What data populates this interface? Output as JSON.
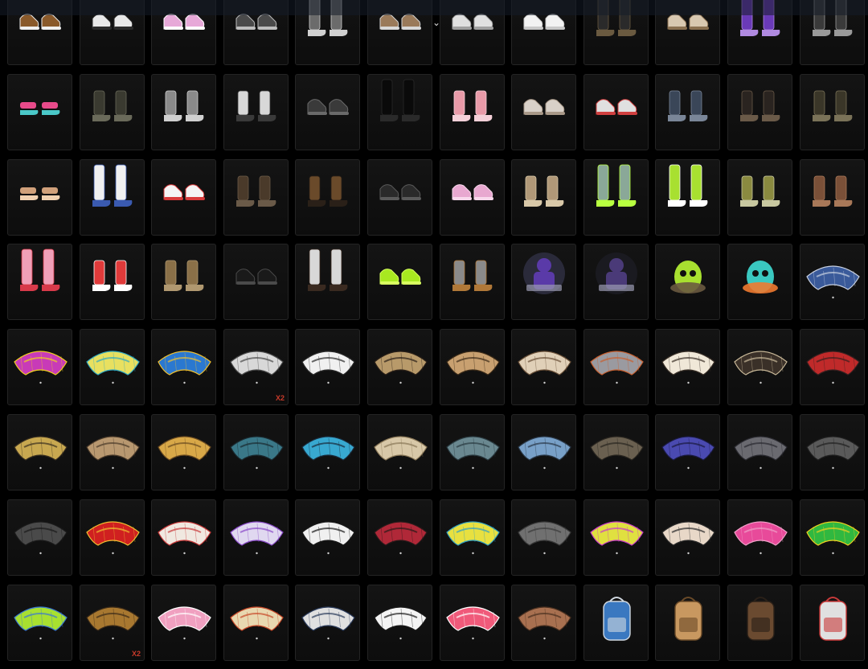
{
  "inventory": {
    "rows": [
      [
        {
          "kind": "shoes",
          "colors": [
            "#8a5a2b",
            "#f0f0f0"
          ],
          "style": "sneaker"
        },
        {
          "kind": "shoes",
          "colors": [
            "#e8e8e8",
            "#2a2a2a"
          ],
          "style": "sneaker"
        },
        {
          "kind": "shoes",
          "colors": [
            "#e7a9d8",
            "#ffffff"
          ],
          "style": "sneaker"
        },
        {
          "kind": "shoes",
          "colors": [
            "#4a4a4a",
            "#bdbdbd"
          ],
          "style": "sneaker"
        },
        {
          "kind": "shoes",
          "colors": [
            "#6b6b6b",
            "#d0d0d0"
          ],
          "style": "tall"
        },
        {
          "kind": "shoes",
          "colors": [
            "#9a7a5a",
            "#d8d8d8"
          ],
          "style": "sneaker"
        },
        {
          "kind": "shoes",
          "colors": [
            "#e0e0e0",
            "#a0a0a0"
          ],
          "style": "sneaker"
        },
        {
          "kind": "shoes",
          "colors": [
            "#f2f2f2",
            "#c8c8c8"
          ],
          "style": "sneaker"
        },
        {
          "kind": "shoes",
          "colors": [
            "#2a2a2a",
            "#6a5a40"
          ],
          "style": "tall"
        },
        {
          "kind": "shoes",
          "colors": [
            "#d8c8b0",
            "#8a7050"
          ],
          "style": "sneaker"
        },
        {
          "kind": "shoes",
          "colors": [
            "#6a3ab8",
            "#b08ae0"
          ],
          "style": "tall"
        },
        {
          "kind": "shoes",
          "colors": [
            "#3a3a3a",
            "#9a9a9a"
          ],
          "style": "tall"
        }
      ],
      [
        {
          "kind": "shoes",
          "colors": [
            "#e84a8a",
            "#4ac8c8"
          ],
          "style": "sandal"
        },
        {
          "kind": "shoes",
          "colors": [
            "#3a3a30",
            "#6a6a5a"
          ],
          "style": "boot"
        },
        {
          "kind": "shoes",
          "colors": [
            "#8a8a8a",
            "#d0d0d0"
          ],
          "style": "boot"
        },
        {
          "kind": "shoes",
          "colors": [
            "#d8d8d8",
            "#3a3a3a"
          ],
          "style": "boot"
        },
        {
          "kind": "shoes",
          "colors": [
            "#3a3a3a",
            "#6a6a6a"
          ],
          "style": "sneaker"
        },
        {
          "kind": "shoes",
          "colors": [
            "#0a0a0a",
            "#2a2a2a"
          ],
          "style": "tall"
        },
        {
          "kind": "shoes",
          "colors": [
            "#e89aa8",
            "#f4d0d8"
          ],
          "style": "boot"
        },
        {
          "kind": "shoes",
          "colors": [
            "#d8d0c8",
            "#a89888"
          ],
          "style": "sneaker"
        },
        {
          "kind": "shoes",
          "colors": [
            "#e0e0e0",
            "#d04040"
          ],
          "style": "sneaker"
        },
        {
          "kind": "shoes",
          "colors": [
            "#3a4658",
            "#7a8698"
          ],
          "style": "boot"
        },
        {
          "kind": "shoes",
          "colors": [
            "#2a2420",
            "#6a5a48"
          ],
          "style": "boot"
        },
        {
          "kind": "shoes",
          "colors": [
            "#3a3628",
            "#7a7258"
          ],
          "style": "boot"
        }
      ],
      [
        {
          "kind": "shoes",
          "colors": [
            "#d0a07a",
            "#f0d0b0"
          ],
          "style": "sandal"
        },
        {
          "kind": "shoes",
          "colors": [
            "#f0f0f0",
            "#3a5ab0"
          ],
          "style": "tall"
        },
        {
          "kind": "shoes",
          "colors": [
            "#f4f4f4",
            "#d83a3a"
          ],
          "style": "sneaker"
        },
        {
          "kind": "shoes",
          "colors": [
            "#4a3a2a",
            "#6a5a48"
          ],
          "style": "boot"
        },
        {
          "kind": "shoes",
          "colors": [
            "#6a4a2a",
            "#2a2018"
          ],
          "style": "boot"
        },
        {
          "kind": "shoes",
          "colors": [
            "#2a2a2a",
            "#5a5a5a"
          ],
          "style": "sneaker"
        },
        {
          "kind": "shoes",
          "colors": [
            "#e8a8d0",
            "#f8d8ec"
          ],
          "style": "sneaker"
        },
        {
          "kind": "shoes",
          "colors": [
            "#b09878",
            "#d8c8a8"
          ],
          "style": "boot"
        },
        {
          "kind": "shoes",
          "colors": [
            "#8aa898",
            "#b8ff40"
          ],
          "style": "tall"
        },
        {
          "kind": "shoes",
          "colors": [
            "#a8e030",
            "#ffffff"
          ],
          "style": "tall"
        },
        {
          "kind": "shoes",
          "colors": [
            "#8a8a40",
            "#c8c8a0"
          ],
          "style": "boot"
        },
        {
          "kind": "shoes",
          "colors": [
            "#7a5038",
            "#a87858"
          ],
          "style": "boot"
        }
      ],
      [
        {
          "kind": "shoes",
          "colors": [
            "#f0a0b8",
            "#d83a4a"
          ],
          "style": "tall"
        },
        {
          "kind": "shoes",
          "colors": [
            "#e03a3a",
            "#ffffff"
          ],
          "style": "boot"
        },
        {
          "kind": "shoes",
          "colors": [
            "#8a7048",
            "#b09870"
          ],
          "style": "boot"
        },
        {
          "kind": "shoes",
          "colors": [
            "#1a1a1a",
            "#4a4a4a"
          ],
          "style": "sneaker"
        },
        {
          "kind": "shoes",
          "colors": [
            "#d8d8d8",
            "#3a2a20"
          ],
          "style": "tall"
        },
        {
          "kind": "shoes",
          "colors": [
            "#a8e820",
            "#d8ff60"
          ],
          "style": "sneaker"
        },
        {
          "kind": "shoes",
          "colors": [
            "#8a8a8a",
            "#b07838"
          ],
          "style": "boot"
        },
        {
          "kind": "emote",
          "colors": [
            "#5a3aa8",
            "#2a2a3a"
          ],
          "style": "character"
        },
        {
          "kind": "emote",
          "colors": [
            "#4a3a78",
            "#1a1a20"
          ],
          "style": "character"
        },
        {
          "kind": "emote",
          "colors": [
            "#a8e030",
            "#6a5a40"
          ],
          "style": "creature"
        },
        {
          "kind": "emote",
          "colors": [
            "#3ac8c0",
            "#f07a30"
          ],
          "style": "creature"
        },
        {
          "kind": "parachute",
          "colors": [
            "#3a5a9a",
            "#c8d0e0"
          ],
          "style": "canopy"
        }
      ],
      [
        {
          "kind": "parachute",
          "colors": [
            "#c83ab8",
            "#f0d020"
          ],
          "style": "canopy"
        },
        {
          "kind": "parachute",
          "colors": [
            "#e8e060",
            "#30a8c0"
          ],
          "style": "canopy"
        },
        {
          "kind": "parachute",
          "colors": [
            "#2a78d0",
            "#f0c030"
          ],
          "style": "canopy"
        },
        {
          "kind": "parachute",
          "colors": [
            "#d8d8d8",
            "#4a4a4a"
          ],
          "style": "canopy",
          "qty": "X2"
        },
        {
          "kind": "parachute",
          "colors": [
            "#f0f0f0",
            "#2a2a2a"
          ],
          "style": "canopy"
        },
        {
          "kind": "parachute",
          "colors": [
            "#b89a6a",
            "#2a2018"
          ],
          "style": "canopy"
        },
        {
          "kind": "parachute",
          "colors": [
            "#c8a070",
            "#3a2a18"
          ],
          "style": "canopy"
        },
        {
          "kind": "parachute",
          "colors": [
            "#e0d0b8",
            "#6a5038"
          ],
          "style": "canopy"
        },
        {
          "kind": "parachute",
          "colors": [
            "#9a9aa0",
            "#c86030"
          ],
          "style": "canopy"
        },
        {
          "kind": "parachute",
          "colors": [
            "#f0e8d8",
            "#3a3028"
          ],
          "style": "canopy"
        },
        {
          "kind": "parachute",
          "colors": [
            "#3a3028",
            "#c8b898"
          ],
          "style": "canopy"
        },
        {
          "kind": "parachute",
          "colors": [
            "#c02a2a",
            "#3a2020"
          ],
          "style": "canopy"
        }
      ],
      [
        {
          "kind": "parachute",
          "colors": [
            "#c8a850",
            "#3a3020"
          ],
          "style": "canopy"
        },
        {
          "kind": "parachute",
          "colors": [
            "#b89870",
            "#4a3a2a"
          ],
          "style": "canopy"
        },
        {
          "kind": "parachute",
          "colors": [
            "#d8a848",
            "#6a4a20"
          ],
          "style": "canopy"
        },
        {
          "kind": "parachute",
          "colors": [
            "#3a7888",
            "#1a2a30"
          ],
          "style": "canopy"
        },
        {
          "kind": "parachute",
          "colors": [
            "#38a8d0",
            "#1a2a3a"
          ],
          "style": "canopy"
        },
        {
          "kind": "parachute",
          "colors": [
            "#d8c8a8",
            "#8a7858"
          ],
          "style": "canopy"
        },
        {
          "kind": "parachute",
          "colors": [
            "#6a8890",
            "#2a3a40"
          ],
          "style": "canopy"
        },
        {
          "kind": "parachute",
          "colors": [
            "#78a0c8",
            "#2a3848"
          ],
          "style": "canopy"
        },
        {
          "kind": "parachute",
          "colors": [
            "#6a6050",
            "#2a2620"
          ],
          "style": "canopy"
        },
        {
          "kind": "parachute",
          "colors": [
            "#4a4ab0",
            "#1a1a40"
          ],
          "style": "canopy"
        },
        {
          "kind": "parachute",
          "colors": [
            "#6a6a70",
            "#2a2a30"
          ],
          "style": "canopy"
        },
        {
          "kind": "parachute",
          "colors": [
            "#5a5a5a",
            "#202020"
          ],
          "style": "canopy"
        }
      ],
      [
        {
          "kind": "parachute",
          "colors": [
            "#4a4a4a",
            "#1a1a1a"
          ],
          "style": "canopy"
        },
        {
          "kind": "parachute",
          "colors": [
            "#d02020",
            "#f0c030"
          ],
          "style": "canopy"
        },
        {
          "kind": "parachute",
          "colors": [
            "#f0e8e0",
            "#c83a3a"
          ],
          "style": "canopy"
        },
        {
          "kind": "parachute",
          "colors": [
            "#e0d8f0",
            "#8a4ac8"
          ],
          "style": "canopy"
        },
        {
          "kind": "parachute",
          "colors": [
            "#f0f0f0",
            "#1a1a1a"
          ],
          "style": "canopy"
        },
        {
          "kind": "parachute",
          "colors": [
            "#b02838",
            "#2a1a1a"
          ],
          "style": "canopy"
        },
        {
          "kind": "parachute",
          "colors": [
            "#e8e040",
            "#30a0c0"
          ],
          "style": "canopy"
        },
        {
          "kind": "parachute",
          "colors": [
            "#707070",
            "#3a3a3a"
          ],
          "style": "canopy"
        },
        {
          "kind": "parachute",
          "colors": [
            "#e0e040",
            "#c83ac8"
          ],
          "style": "canopy"
        },
        {
          "kind": "parachute",
          "colors": [
            "#e8d8c8",
            "#2a2a2a"
          ],
          "style": "canopy"
        },
        {
          "kind": "parachute",
          "colors": [
            "#e84a9a",
            "#f0a0c8"
          ],
          "style": "canopy"
        },
        {
          "kind": "parachute",
          "colors": [
            "#30b840",
            "#f0d020"
          ],
          "style": "canopy"
        }
      ],
      [
        {
          "kind": "parachute",
          "colors": [
            "#a8e030",
            "#3a78d0"
          ],
          "style": "canopy"
        },
        {
          "kind": "parachute",
          "colors": [
            "#a87830",
            "#3a2a18"
          ],
          "style": "canopy",
          "qty": "X2"
        },
        {
          "kind": "parachute",
          "colors": [
            "#f0a0c0",
            "#ffffff"
          ],
          "style": "canopy"
        },
        {
          "kind": "parachute",
          "colors": [
            "#e8d8b0",
            "#c84a2a"
          ],
          "style": "canopy"
        },
        {
          "kind": "parachute",
          "colors": [
            "#e0e0e0",
            "#2a3a5a"
          ],
          "style": "canopy"
        },
        {
          "kind": "parachute",
          "colors": [
            "#f4f4f4",
            "#1a1a1a"
          ],
          "style": "canopy"
        },
        {
          "kind": "parachute",
          "colors": [
            "#f05a7a",
            "#ffffff"
          ],
          "style": "canopy"
        },
        {
          "kind": "parachute",
          "colors": [
            "#a87050",
            "#4a3020"
          ],
          "style": "canopy"
        },
        {
          "kind": "backpack",
          "colors": [
            "#3a78c0",
            "#d0d8e0"
          ],
          "style": "pack"
        },
        {
          "kind": "backpack",
          "colors": [
            "#c89860",
            "#6a4a28"
          ],
          "style": "pack"
        },
        {
          "kind": "backpack",
          "colors": [
            "#6a4a30",
            "#2a2018"
          ],
          "style": "pack"
        },
        {
          "kind": "backpack",
          "colors": [
            "#e0e0e0",
            "#c83a3a"
          ],
          "style": "pack"
        }
      ]
    ]
  },
  "ui": {
    "accent": "#c83a2a",
    "scroll_chevron": "chevron-down-icon"
  }
}
